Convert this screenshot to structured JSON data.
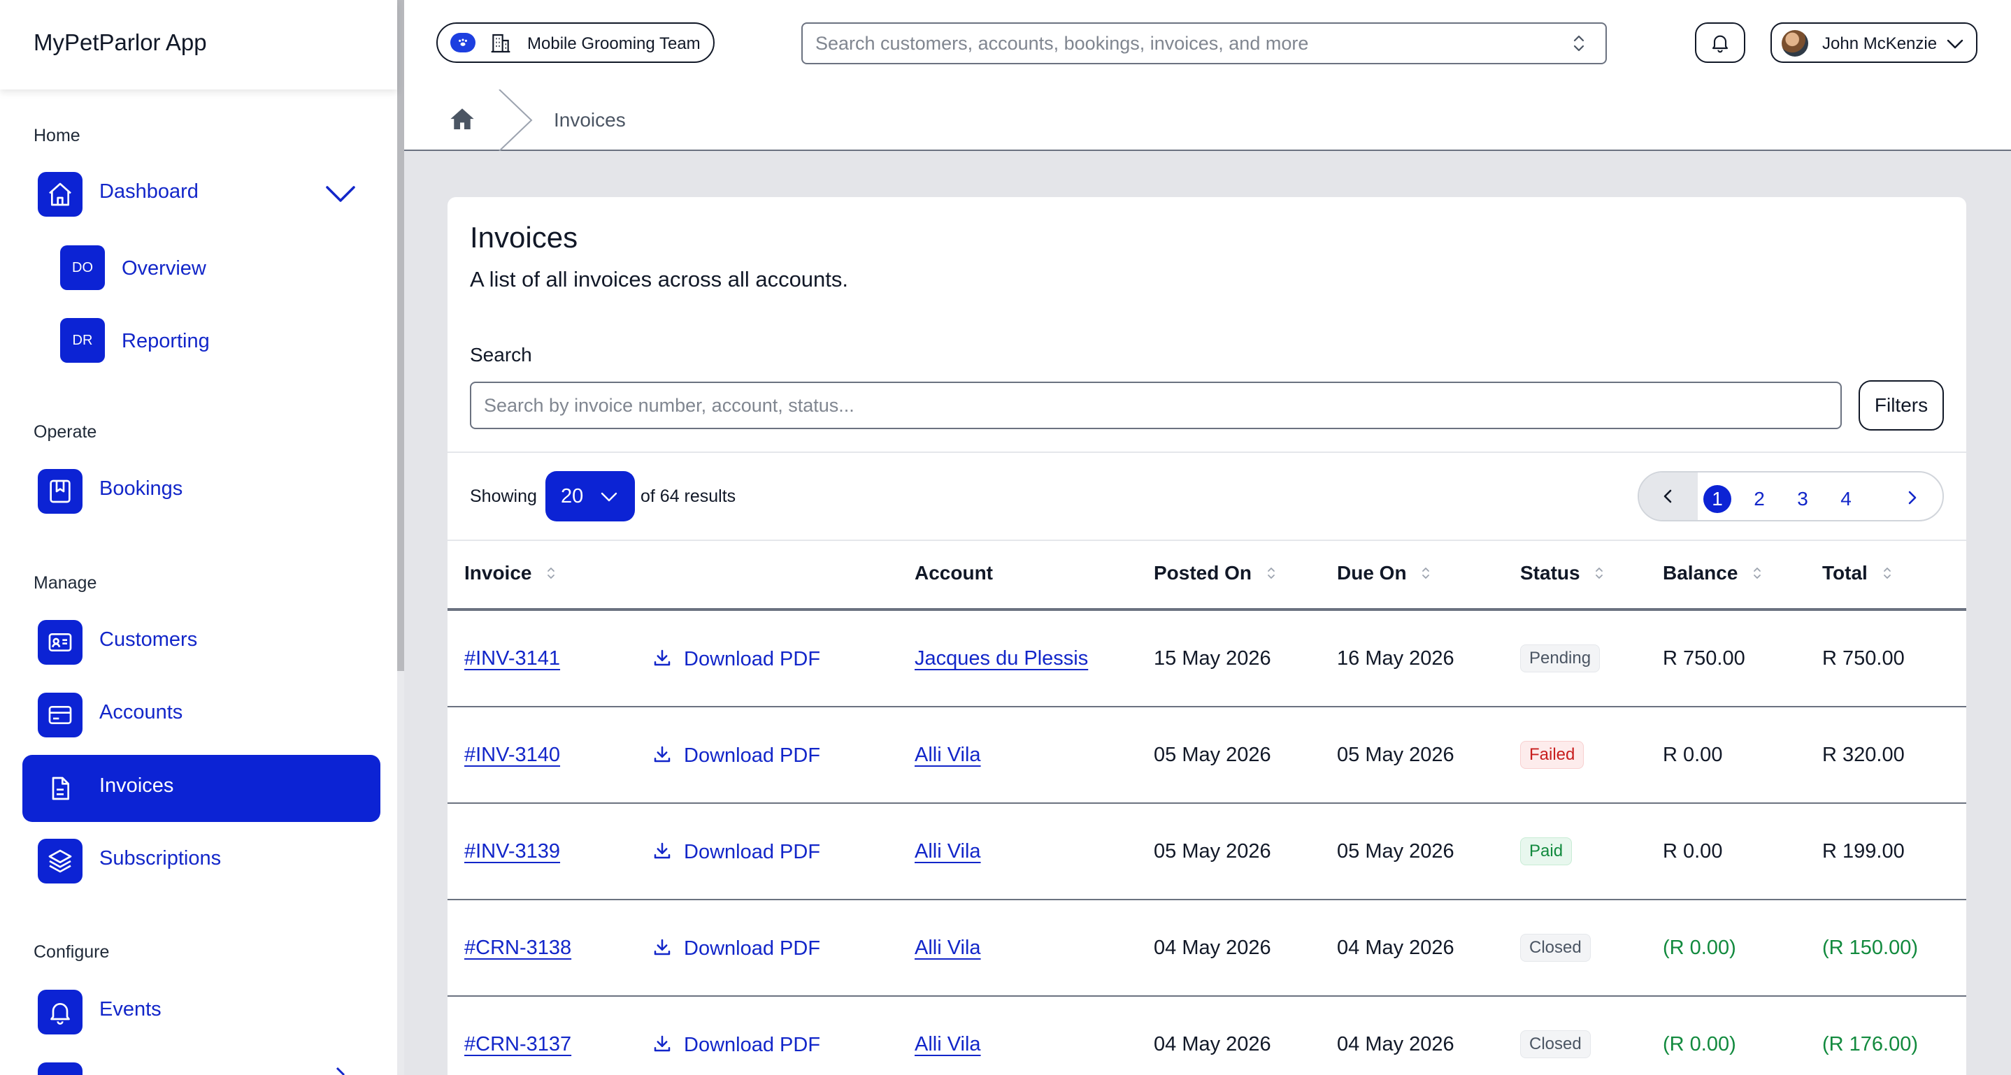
{
  "app": {
    "title": "MyPetParlor App"
  },
  "sidebar": {
    "sections": {
      "home": "Home",
      "operate": "Operate",
      "manage": "Manage",
      "configure": "Configure"
    },
    "dashboard": {
      "label": "Dashboard",
      "icon": "home-icon"
    },
    "subitems": [
      {
        "badge": "DO",
        "label": "Overview"
      },
      {
        "badge": "DR",
        "label": "Reporting"
      }
    ],
    "items": [
      {
        "label": "Bookings",
        "icon": "bookmark-icon"
      },
      {
        "label": "Customers",
        "icon": "contact-card-icon"
      },
      {
        "label": "Accounts",
        "icon": "credit-card-icon"
      },
      {
        "label": "Invoices",
        "icon": "document-icon",
        "active": true
      },
      {
        "label": "Subscriptions",
        "icon": "layers-icon"
      },
      {
        "label": "Events",
        "icon": "bell-icon"
      }
    ]
  },
  "topbar": {
    "team": "Mobile Grooming Team",
    "search_placeholder": "Search customers, accounts, bookings, invoices, and more",
    "user_name": "John McKenzie"
  },
  "breadcrumb": {
    "current": "Invoices"
  },
  "page": {
    "title": "Invoices",
    "subtitle": "A list of all invoices across all accounts.",
    "search_label": "Search",
    "search_placeholder": "Search by invoice number, account, status...",
    "filters_label": "Filters"
  },
  "pagination": {
    "showing_label": "Showing",
    "page_size": "20",
    "results_label": "of 64 results",
    "pages": [
      "1",
      "2",
      "3",
      "4"
    ],
    "current_page": "1"
  },
  "table": {
    "headers": {
      "invoice": "Invoice",
      "account": "Account",
      "posted_on": "Posted On",
      "due_on": "Due On",
      "status": "Status",
      "balance": "Balance",
      "total": "Total"
    },
    "download_label": "Download PDF",
    "rows": [
      {
        "invoice": "#INV-3141",
        "account": "Jacques du Plessis",
        "posted": "15 May 2026",
        "due": "16 May 2026",
        "status": "Pending",
        "status_kind": "pending",
        "balance": "R 750.00",
        "total": "R 750.00",
        "credit": false
      },
      {
        "invoice": "#INV-3140",
        "account": "Alli Vila",
        "posted": "05 May 2026",
        "due": "05 May 2026",
        "status": "Failed",
        "status_kind": "failed",
        "balance": "R 0.00",
        "total": "R 320.00",
        "credit": false
      },
      {
        "invoice": "#INV-3139",
        "account": "Alli Vila",
        "posted": "05 May 2026",
        "due": "05 May 2026",
        "status": "Paid",
        "status_kind": "paid",
        "balance": "R 0.00",
        "total": "R 199.00",
        "credit": false
      },
      {
        "invoice": "#CRN-3138",
        "account": "Alli Vila",
        "posted": "04 May 2026",
        "due": "04 May 2026",
        "status": "Closed",
        "status_kind": "closed",
        "balance": "(R 0.00)",
        "total": "(R 150.00)",
        "credit": true
      },
      {
        "invoice": "#CRN-3137",
        "account": "Alli Vila",
        "posted": "04 May 2026",
        "due": "04 May 2026",
        "status": "Closed",
        "status_kind": "closed",
        "balance": "(R 0.00)",
        "total": "(R 176.00)",
        "credit": true
      }
    ]
  },
  "colors": {
    "brand": "#0c23d4",
    "link": "#1226c9",
    "credit": "#128a3e",
    "failed": "#c81e1e",
    "paid": "#128a3e"
  }
}
